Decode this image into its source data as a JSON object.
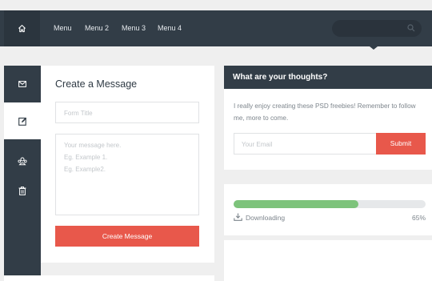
{
  "nav": {
    "home_icon": "home-icon",
    "items": [
      "Menu",
      "Menu 2",
      "Menu 3",
      "Menu 4"
    ],
    "search_icon": "search-icon",
    "colors": {
      "bar": "#323d47",
      "home_bg": "#2b353e"
    }
  },
  "sidebar": {
    "items": [
      {
        "icon": "mail-icon"
      },
      {
        "icon": "edit-icon",
        "active": true
      },
      {
        "icon": "users-icon"
      },
      {
        "icon": "trash-icon"
      }
    ]
  },
  "message": {
    "title": "Create a Message",
    "form_title_placeholder": "Form Title",
    "body_placeholder_lines": [
      "Your message here.",
      "Eg. Example 1.",
      "Eg. Example2."
    ],
    "submit_label": "Create Message"
  },
  "thoughts": {
    "title": "What are your thoughts?",
    "text": "I really enjoy creating these PSD freebies! Remember to follow me, more to come.",
    "email_placeholder": "Your Email",
    "submit_label": "Submit"
  },
  "download": {
    "icon": "download-icon",
    "label": "Downloading",
    "percent_text": "65%",
    "progress": 0.65
  },
  "colors": {
    "accent_red": "#e8584b",
    "progress_green": "#7dc37b",
    "dark": "#323d47"
  }
}
